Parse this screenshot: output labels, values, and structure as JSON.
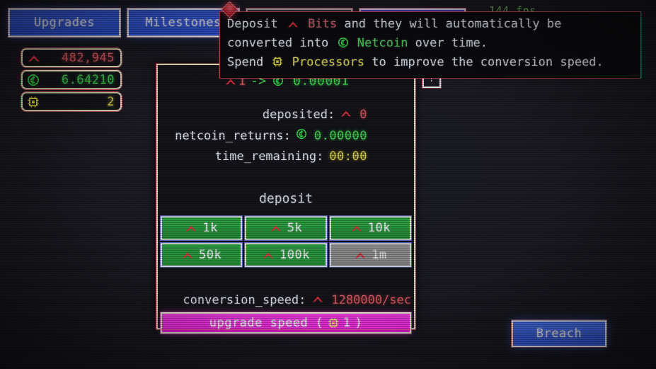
{
  "tabs": [
    {
      "label": "Upgrades",
      "state": "active"
    },
    {
      "label": "Milestones",
      "state": "active"
    },
    {
      "label": "",
      "state": "partial"
    },
    {
      "label": "",
      "state": "partial"
    }
  ],
  "fps": {
    "text": "144 fps"
  },
  "resources": [
    {
      "name": "bits",
      "icon": "caret-icon",
      "value": "482,945",
      "color": "#e8606a"
    },
    {
      "name": "netcoin",
      "icon": "netcoin-icon",
      "value": "6.64210",
      "color": "#49e05a"
    },
    {
      "name": "processor",
      "icon": "processor-icon",
      "value": "2",
      "color": "#e8e052"
    }
  ],
  "tooltip": {
    "line1_a": "Deposit ",
    "line1_bits": "Bits",
    "line1_b": " and they will automatically be",
    "line2_a": "converted into ",
    "line2_net": "Netcoin",
    "line2_b": " over time.",
    "line3_a": "Spend ",
    "line3_proc": "Processors",
    "line3_b": " to improve the conversion speed."
  },
  "panel": {
    "rate": {
      "amount": "1",
      "arrow": "->",
      "output": "0.00001"
    },
    "stats": [
      {
        "label": "deposited:",
        "value": "0",
        "icon": "caret-icon",
        "color": "red"
      },
      {
        "label": "netcoin_returns:",
        "value": "0.00000",
        "icon": "netcoin-icon",
        "color": "green"
      },
      {
        "label": "time_remaining:",
        "value": "00:00",
        "icon": "none",
        "color": "yellow"
      }
    ],
    "deposit_label": "deposit",
    "deposit_buttons": [
      {
        "label": "1k",
        "enabled": true
      },
      {
        "label": "5k",
        "enabled": true
      },
      {
        "label": "10k",
        "enabled": true
      },
      {
        "label": "50k",
        "enabled": true
      },
      {
        "label": "100k",
        "enabled": true
      },
      {
        "label": "1m",
        "enabled": false
      }
    ],
    "conversion_speed": {
      "label": "conversion_speed:",
      "value": "1280000/sec"
    },
    "upgrade": {
      "prefix": "upgrade speed (",
      "cost": "1",
      "suffix": ")"
    }
  },
  "help_button": {
    "label": "?"
  },
  "breach_button": {
    "label": "Breach"
  },
  "colors": {
    "bits": "#e8606a",
    "netcoin": "#49e05a",
    "processor": "#e8e052",
    "accent_blue": "#3558e0",
    "upgrade_pink": "#f024e0",
    "panel_border": "#f0eec6",
    "background": "#15151b"
  }
}
